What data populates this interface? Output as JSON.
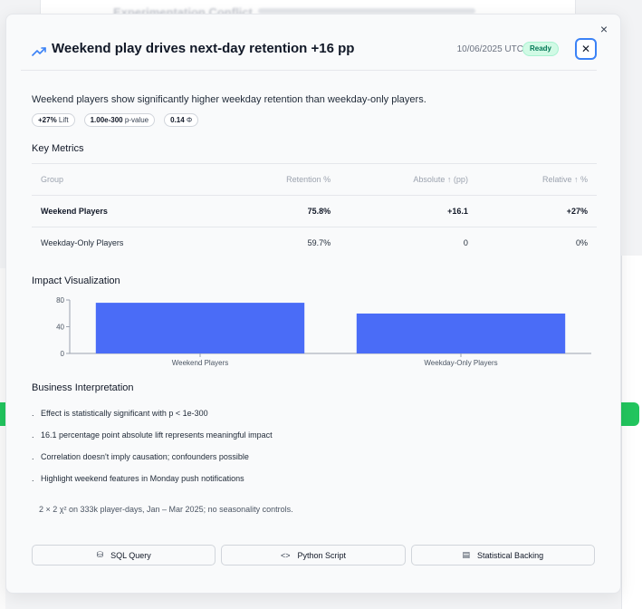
{
  "header": {
    "title": "Weekend play drives next-day retention +16 pp",
    "timestamp": "10/06/2025 UTC",
    "status": "Ready",
    "close_symbol": "✕",
    "outer_close_symbol": "×"
  },
  "summary": "Weekend players show significantly higher weekday retention than weekday-only players.",
  "chips": [
    {
      "value": "+27%",
      "label": "Lift"
    },
    {
      "value": "1.00e-300",
      "label": "p-value"
    },
    {
      "value": "0.14",
      "label": "Φ"
    }
  ],
  "key_metrics": {
    "title": "Key Metrics",
    "columns": [
      "Group",
      "Retention %",
      "Absolute ↑ (pp)",
      "Relative ↑ %"
    ],
    "rows": [
      {
        "group": "Weekend Players",
        "retention": "75.8%",
        "absolute": "+16.1",
        "relative": "+27%"
      },
      {
        "group": "Weekday-Only Players",
        "retention": "59.7%",
        "absolute": "0",
        "relative": "0%"
      }
    ]
  },
  "impact": {
    "title": "Impact Visualization"
  },
  "chart_data": {
    "type": "bar",
    "categories": [
      "Weekend Players",
      "Weekday-Only Players"
    ],
    "values": [
      75.8,
      59.7
    ],
    "title": "",
    "xlabel": "",
    "ylabel": "",
    "ylim": [
      0,
      80
    ],
    "yticks": [
      0,
      40,
      80
    ],
    "bar_color": "#4a6cf7",
    "grid": false
  },
  "interpretation": {
    "title": "Business Interpretation",
    "items": [
      "Effect is statistically significant with p < 1e-300",
      "16.1 percentage point absolute lift represents meaningful impact",
      "Correlation doesn't imply causation; confounders possible",
      "Highlight weekend features in Monday push notifications"
    ],
    "footnote": "2 × 2 χ² on 333k player-days, Jan – Mar 2025; no seasonality controls."
  },
  "actions": [
    {
      "icon": "database-icon",
      "glyph": "⛁",
      "label": "SQL Query"
    },
    {
      "icon": "code-icon",
      "glyph": "<>",
      "label": "Python Script"
    },
    {
      "icon": "document-icon",
      "glyph": "▤",
      "label": "Statistical Backing"
    }
  ],
  "background": {
    "card_title": "Experimentation Conflict"
  },
  "colors": {
    "accent": "#3b82f6",
    "status_bg": "#d1fae5",
    "status_text": "#047857",
    "bar": "#4a6cf7"
  }
}
